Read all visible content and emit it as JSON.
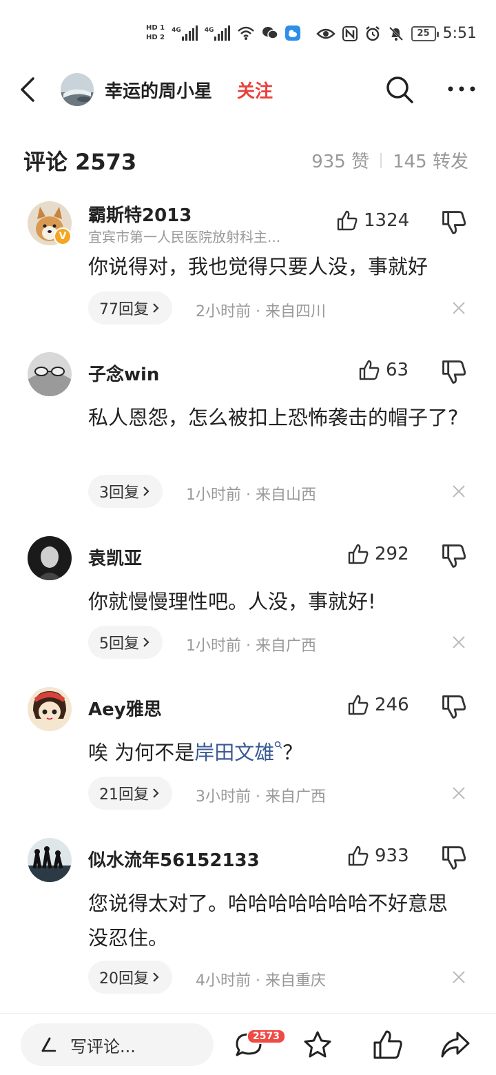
{
  "status_bar": {
    "hd1": "HD 1",
    "hd2": "HD 2",
    "net1": "4G",
    "net2": "4G",
    "battery": "25",
    "time": "5:51"
  },
  "header": {
    "user_name": "幸运的周小星",
    "follow_label": "关注"
  },
  "comments_header": {
    "title": "评论 2573",
    "likes": "935 赞",
    "reposts": "145 转发"
  },
  "comments": [
    {
      "name": "霸斯特2013",
      "subtitle": "宜宾市第一人民医院放射科主...",
      "verified": true,
      "likes": "1324",
      "text": "你说得对，我也觉得只要人没，事就好",
      "replies": "77回复",
      "meta": "2小时前 · 来自四川"
    },
    {
      "name": "子念win",
      "likes": "63",
      "text": "私人恩怨，怎么被扣上恐怖袭击的帽子了?",
      "replies": "3回复",
      "meta": "1小时前 · 来自山西"
    },
    {
      "name": "袁凯亚",
      "likes": "292",
      "text": "你就慢慢理性吧。人没，事就好!",
      "replies": "5回复",
      "meta": "1小时前 · 来自广西"
    },
    {
      "name": "Aey雅思",
      "likes": "246",
      "text_before": "唉 为何不是",
      "text_link": "岸田文雄",
      "text_after": "？",
      "replies": "21回复",
      "meta": "3小时前 · 来自广西"
    },
    {
      "name": "似水流年56152133",
      "likes": "933",
      "text": "您说得太对了。哈哈哈哈哈哈哈不好意思没忍住。",
      "replies": "20回复",
      "meta": "4小时前 · 来自重庆"
    }
  ],
  "bottom_bar": {
    "write_placeholder": "写评论...",
    "comment_count_badge": "2573"
  },
  "icons": {
    "back": "chevron-left-icon",
    "search": "search-icon",
    "more": "more-dots-icon",
    "like": "thumbs-up-icon",
    "dislike": "thumbs-down-icon",
    "close": "close-icon",
    "pen": "pen-icon",
    "comment": "comment-bubble-icon",
    "star": "star-icon",
    "share": "share-arrow-icon"
  },
  "colors": {
    "follow": "#e8413d",
    "link": "#3b5a94",
    "badge": "#f04a44",
    "verified": "#f5a623"
  }
}
